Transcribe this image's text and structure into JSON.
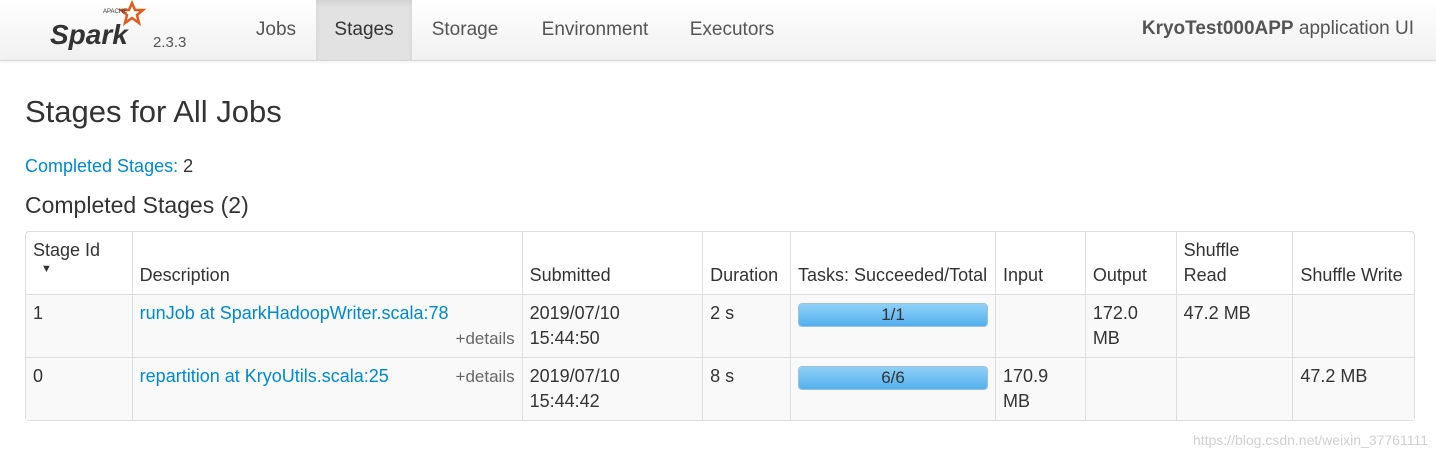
{
  "nav": {
    "brand_text": "Spark",
    "brand_apache": "APACHE",
    "version": "2.3.3",
    "items": [
      "Jobs",
      "Stages",
      "Storage",
      "Environment",
      "Executors"
    ],
    "active": "Stages",
    "app_name": "KryoTest000APP",
    "app_suffix": " application UI"
  },
  "page": {
    "title": "Stages for All Jobs",
    "summary_label": "Completed Stages:",
    "summary_value": "2",
    "section_title": "Completed Stages (2)"
  },
  "table": {
    "headers": [
      "Stage Id",
      "Description",
      "Submitted",
      "Duration",
      "Tasks: Succeeded/Total",
      "Input",
      "Output",
      "Shuffle Read",
      "Shuffle Write"
    ],
    "details_label": "+details",
    "rows": [
      {
        "stage_id": "1",
        "description": "runJob at SparkHadoopWriter.scala:78",
        "submitted_date": "2019/07/10",
        "submitted_time": "15:44:50",
        "duration": "2 s",
        "tasks_text": "1/1",
        "tasks_fraction": 1.0,
        "input": "",
        "output": "172.0 MB",
        "shuffle_read": "47.2 MB",
        "shuffle_write": ""
      },
      {
        "stage_id": "0",
        "description": "repartition at KryoUtils.scala:25",
        "submitted_date": "2019/07/10",
        "submitted_time": "15:44:42",
        "duration": "8 s",
        "tasks_text": "6/6",
        "tasks_fraction": 1.0,
        "input": "170.9 MB",
        "output": "",
        "shuffle_read": "",
        "shuffle_write": "47.2 MB"
      }
    ]
  },
  "watermark": "https://blog.csdn.net/weixin_37761111",
  "colors": {
    "link": "#0088cc",
    "progress": "#52b0ee",
    "brand_orange": "#e25a1c"
  }
}
